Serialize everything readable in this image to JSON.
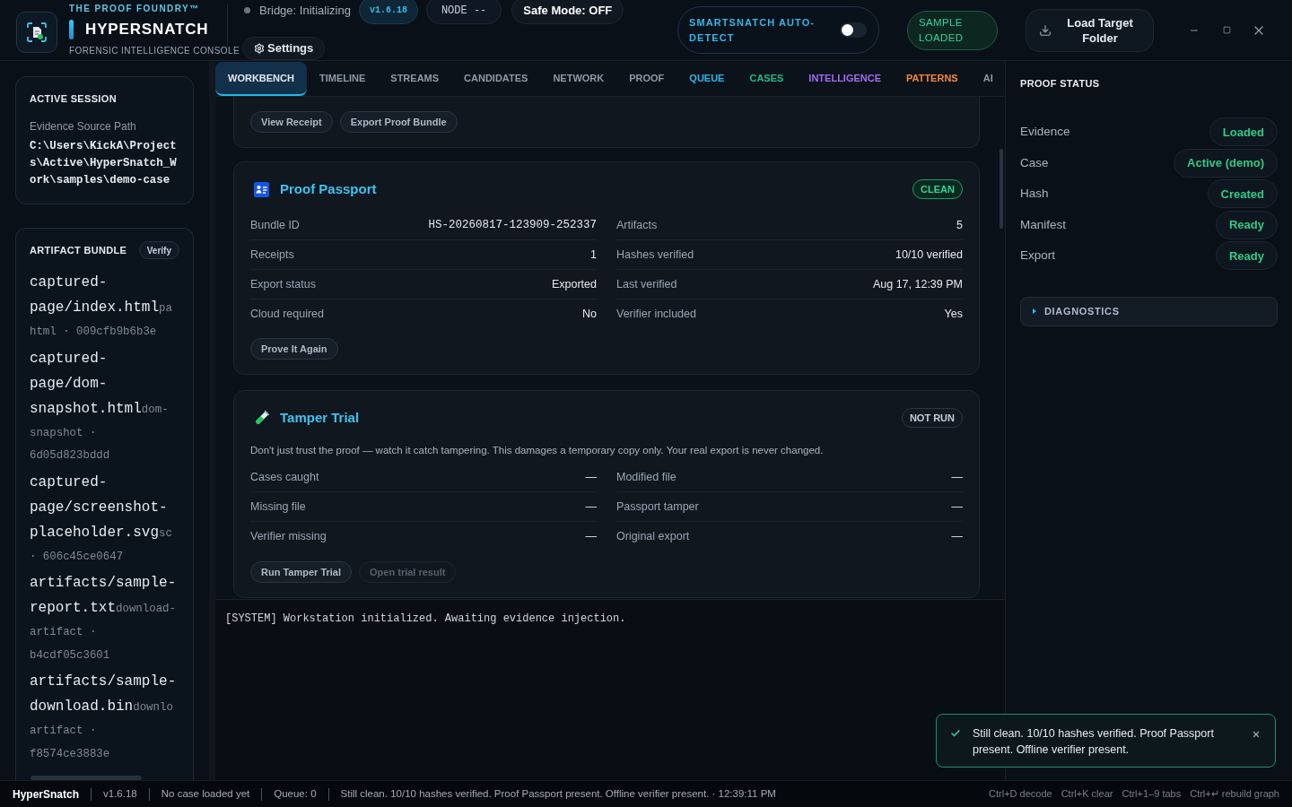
{
  "header": {
    "brand": {
      "eyebrow": "THE PROOF FOUNDRY™",
      "title": "HYPERSNATCH",
      "subtitle": "FORENSIC INTELLIGENCE CONSOLE"
    },
    "bridge": "Bridge: Initializing",
    "version": "v1.6.18",
    "node": "NODE --",
    "safe_mode": "Safe Mode: OFF",
    "settings": "Settings",
    "autodetect": {
      "label": "SMARTSNATCH AUTO-DETECT",
      "on": false
    },
    "sample_badge": "SAMPLE LOADED",
    "load_button": "Load Target Folder"
  },
  "sidebar": {
    "session": {
      "title": "ACTIVE SESSION",
      "label": "Evidence Source Path",
      "path": "C:\\Users\\KickA\\Projects\\Active\\HyperSnatch_Work\\samples\\demo-case"
    },
    "bundle": {
      "title": "ARTIFACT BUNDLE",
      "verify": "Verify",
      "items": [
        {
          "name": "captured-page/index.html",
          "tag": "pa",
          "meta": "html · 009cfb9b6b3e"
        },
        {
          "name": "captured-page/dom-snapshot.html",
          "tag": "dom-",
          "meta": "snapshot · 6d05d823bddd"
        },
        {
          "name": "captured-page/screenshot-placeholder.svg",
          "tag": "sc",
          "meta": "· 606c45ce0647"
        },
        {
          "name": "artifacts/sample-report.txt",
          "tag": "download-",
          "meta": "artifact · b4cdf05c3601"
        },
        {
          "name": "artifacts/sample-download.bin",
          "tag": "downlo",
          "meta": "artifact · f8574ce3883e"
        }
      ]
    }
  },
  "tabs": [
    {
      "label": "WORKBENCH",
      "selected": true,
      "color": "#e2e8f0"
    },
    {
      "label": "TIMELINE",
      "selected": false,
      "color": "#8e9aa7"
    },
    {
      "label": "STREAMS",
      "selected": false,
      "color": "#8e9aa7"
    },
    {
      "label": "CANDIDATES",
      "selected": false,
      "color": "#8e9aa7"
    },
    {
      "label": "NETWORK",
      "selected": false,
      "color": "#8e9aa7"
    },
    {
      "label": "PROOF",
      "selected": false,
      "color": "#8e9aa7"
    },
    {
      "label": "QUEUE",
      "selected": false,
      "color": "#2fb5ea"
    },
    {
      "label": "CASES",
      "selected": false,
      "color": "#1fb985"
    },
    {
      "label": "INTELLIGENCE",
      "selected": false,
      "color": "#a46cf0"
    },
    {
      "label": "PATTERNS",
      "selected": false,
      "color": "#f0883e"
    },
    {
      "label": "AI",
      "selected": false,
      "color": "#8e9aa7"
    }
  ],
  "workbench": {
    "receipt_card": {
      "buttons": [
        "View Receipt",
        "Export Proof Bundle"
      ]
    },
    "passport": {
      "title": "Proof Passport",
      "badge": {
        "text": "CLEAN",
        "kind": "clean"
      },
      "fields": [
        {
          "label": "Bundle ID",
          "value": "HS-20260817-123909-252337",
          "kind": "code"
        },
        {
          "label": "Artifacts",
          "value": "5",
          "kind": "text"
        },
        {
          "label": "Receipts",
          "value": "1",
          "kind": "text"
        },
        {
          "label": "Hashes verified",
          "value": "10/10 verified",
          "kind": "text"
        },
        {
          "label": "Export status",
          "value": "Exported",
          "kind": "text"
        },
        {
          "label": "Last verified",
          "value": "Aug 17, 12:39 PM",
          "kind": "text"
        },
        {
          "label": "Cloud required",
          "value": "No",
          "kind": "text"
        },
        {
          "label": "Verifier included",
          "value": "Yes",
          "kind": "text"
        }
      ],
      "button": "Prove It Again"
    },
    "tamper": {
      "title": "Tamper Trial",
      "badge": {
        "text": "NOT RUN",
        "kind": "idle"
      },
      "description": "Don't just trust the proof — watch it catch tampering. This damages a temporary copy only. Your real export is never changed.",
      "fields": [
        {
          "label": "Cases caught",
          "value": "—"
        },
        {
          "label": "Modified file",
          "value": "—"
        },
        {
          "label": "Missing file",
          "value": "—"
        },
        {
          "label": "Passport tamper",
          "value": "—"
        },
        {
          "label": "Verifier missing",
          "value": "—"
        },
        {
          "label": "Original export",
          "value": "—"
        }
      ],
      "buttons": [
        {
          "label": "Run Tamper Trial",
          "disabled": false
        },
        {
          "label": "Open trial result",
          "disabled": true
        }
      ]
    }
  },
  "log": [
    "[SYSTEM] Workstation initialized. Awaiting evidence injection."
  ],
  "proof_status": {
    "title": "PROOF STATUS",
    "rows": [
      {
        "label": "Evidence",
        "value": "Loaded"
      },
      {
        "label": "Case",
        "value": "Active (demo)"
      },
      {
        "label": "Hash",
        "value": "Created"
      },
      {
        "label": "Manifest",
        "value": "Ready"
      },
      {
        "label": "Export",
        "value": "Ready"
      }
    ],
    "diagnostics": {
      "label": "DIAGNOSTICS",
      "expanded": false
    }
  },
  "toast": {
    "message": "Still clean. 10/10 hashes verified. Proof Passport present. Offline verifier present."
  },
  "status_bar": {
    "app": "HyperSnatch",
    "items": [
      "v1.6.18",
      "No case loaded yet",
      "Queue: 0",
      "Still clean. 10/10 hashes verified. Proof Passport present. Offline verifier present. · 12:39:11 PM"
    ],
    "shortcuts": [
      "Ctrl+D decode",
      "Ctrl+K clear",
      "Ctrl+1–9 tabs",
      "Ctrl+↵ rebuild graph"
    ]
  }
}
